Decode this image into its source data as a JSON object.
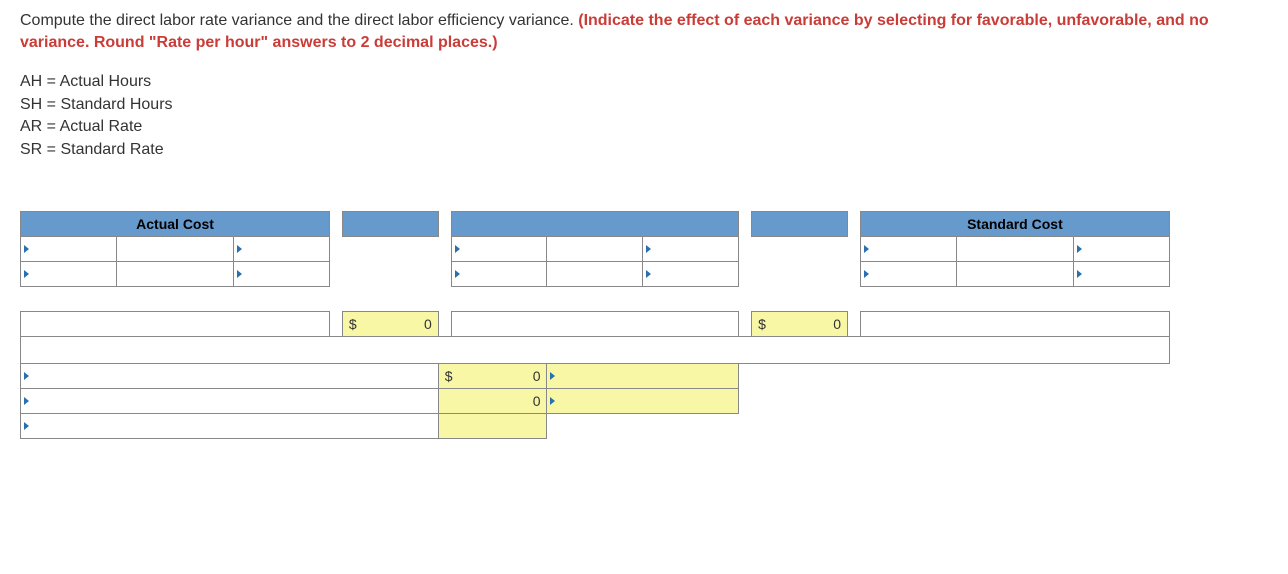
{
  "question": {
    "intro": "Compute the direct labor rate variance and the direct labor efficiency variance. ",
    "emph": "(Indicate the effect of each variance by selecting for favorable, unfavorable, and no variance. Round \"Rate per hour\" answers to 2 decimal places.)"
  },
  "legend": {
    "l1": "AH = Actual Hours",
    "l2": "SH = Standard Hours",
    "l3": "AR = Actual Rate",
    "l4": "SR = Standard Rate"
  },
  "table": {
    "header_left": "Actual Cost",
    "header_right": "Standard Cost",
    "dollar": "$",
    "zero": "0"
  }
}
